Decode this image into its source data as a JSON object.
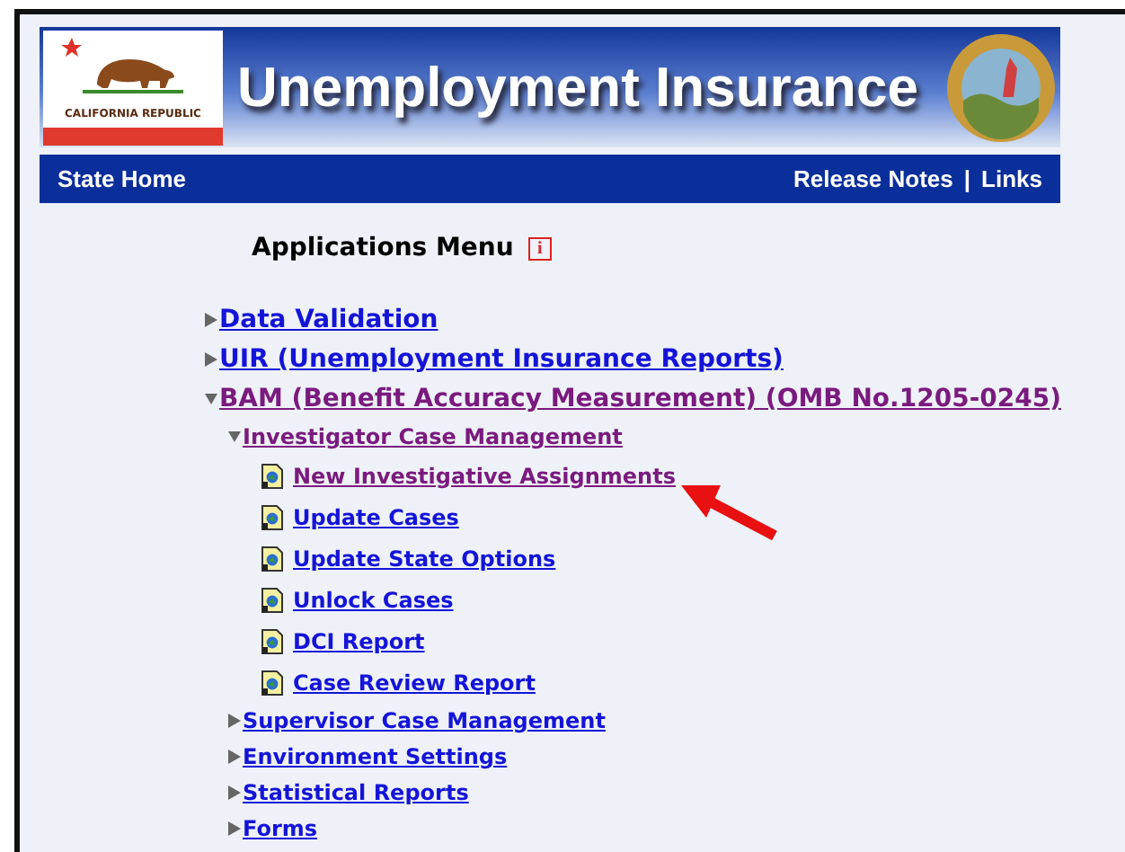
{
  "header": {
    "flag_text": "CALIFORNIA REPUBLIC",
    "title": "Unemployment Insurance"
  },
  "nav": {
    "left": "State Home",
    "links": [
      {
        "label": "Release Notes"
      },
      {
        "label": "Links"
      }
    ],
    "separator": "|"
  },
  "menu": {
    "title": "Applications Menu",
    "info": "i",
    "items": [
      {
        "kind": "folder",
        "label": "Data Validation",
        "expanded": false,
        "visited": false
      },
      {
        "kind": "folder",
        "label": "UIR (Unemployment Insurance Reports)",
        "expanded": false,
        "visited": false
      },
      {
        "kind": "folder",
        "label": "BAM (Benefit Accuracy Measurement) (OMB No.1205-0245)",
        "expanded": true,
        "visited": true,
        "children": [
          {
            "kind": "folder",
            "label": "Investigator Case Management",
            "expanded": true,
            "visited": true,
            "children": [
              {
                "kind": "page",
                "label": "New Investigative Assignments",
                "visited": true
              },
              {
                "kind": "page",
                "label": "Update Cases",
                "visited": false
              },
              {
                "kind": "page",
                "label": "Update State Options",
                "visited": false
              },
              {
                "kind": "page",
                "label": "Unlock Cases",
                "visited": false
              },
              {
                "kind": "page",
                "label": "DCI Report",
                "visited": false
              },
              {
                "kind": "page",
                "label": "Case Review Report",
                "visited": false
              }
            ]
          },
          {
            "kind": "folder",
            "label": "Supervisor Case Management",
            "expanded": false,
            "visited": false
          },
          {
            "kind": "folder",
            "label": "Environment Settings",
            "expanded": false,
            "visited": false
          },
          {
            "kind": "folder",
            "label": "Statistical Reports",
            "expanded": false,
            "visited": false
          },
          {
            "kind": "folder",
            "label": "Forms",
            "expanded": false,
            "visited": false
          }
        ]
      }
    ]
  }
}
